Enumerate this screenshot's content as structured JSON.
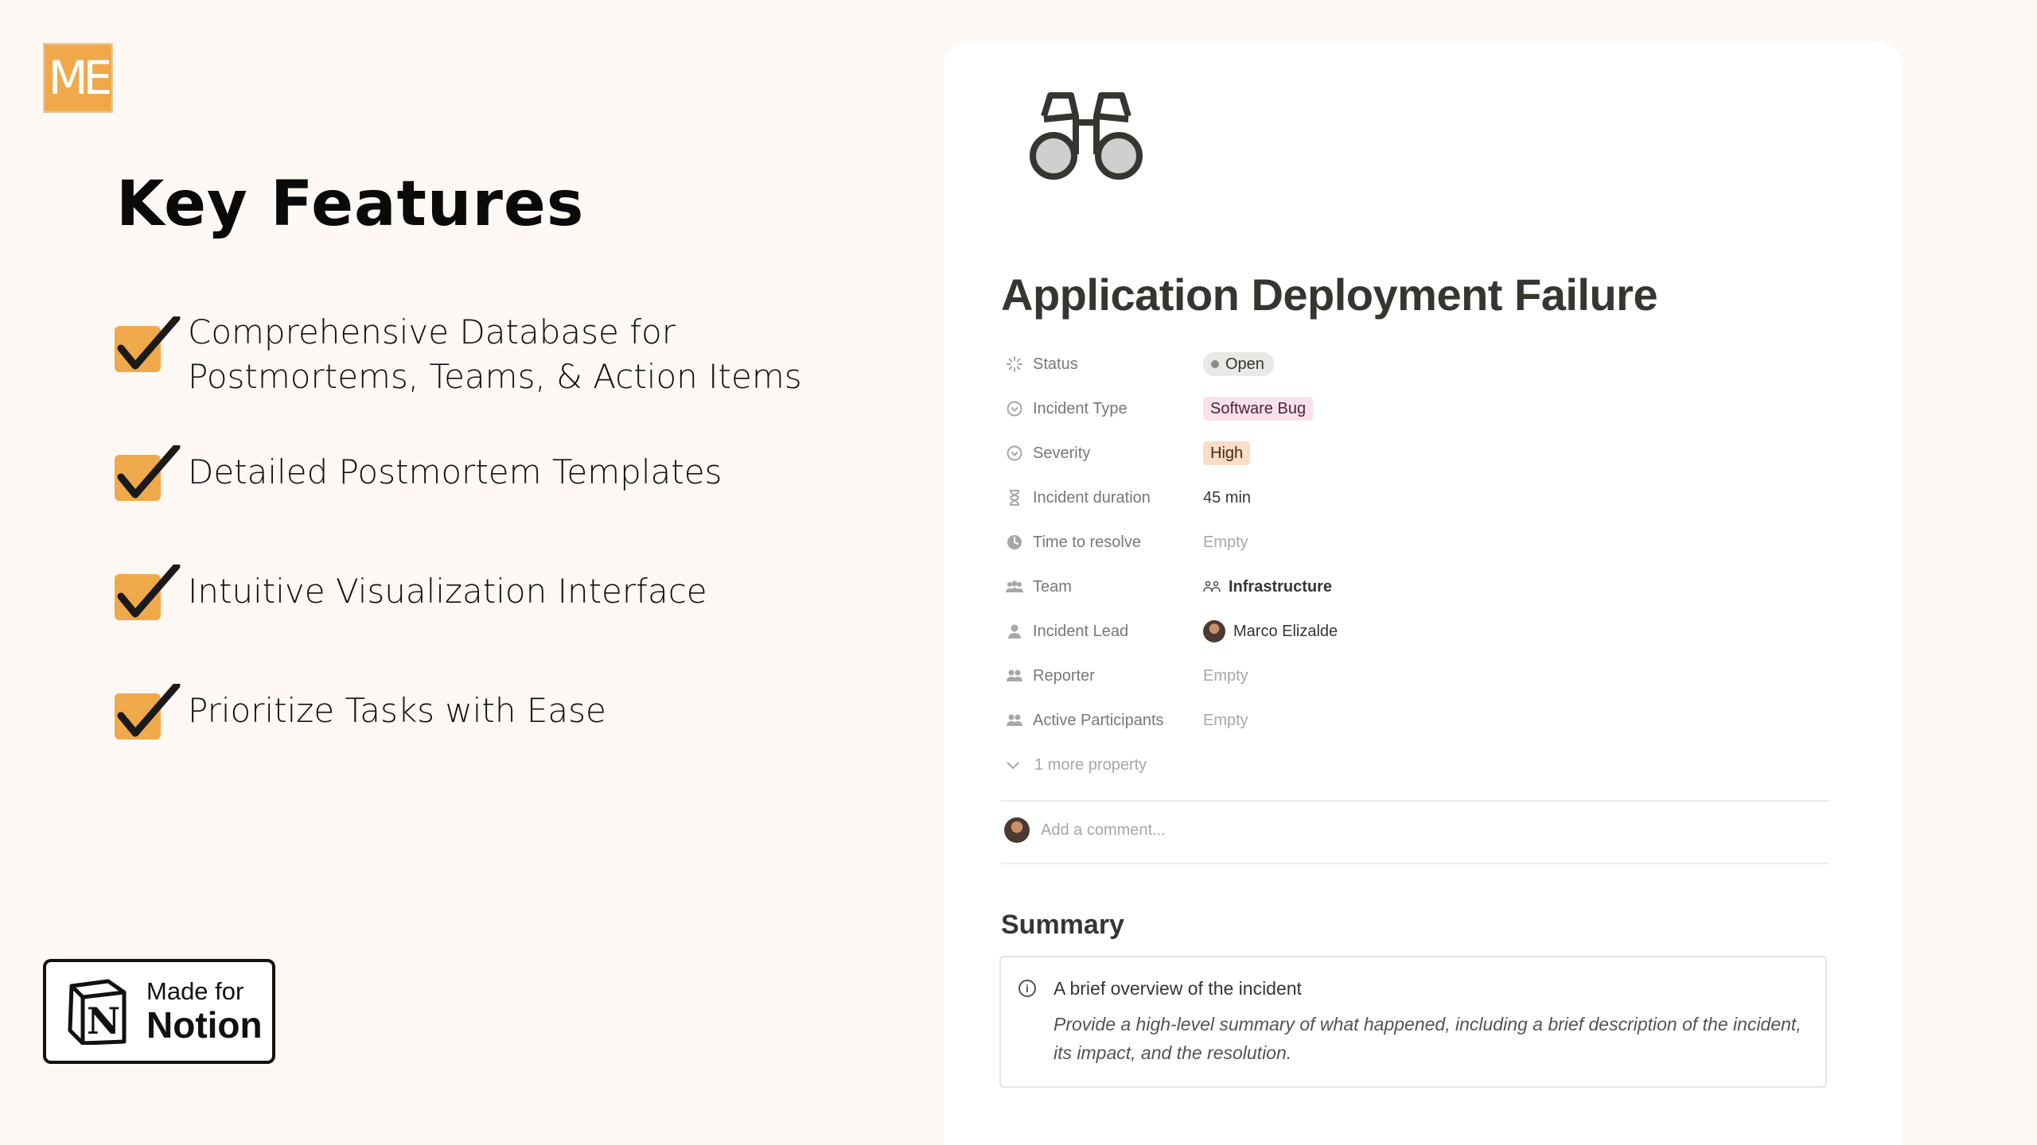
{
  "logo": {
    "text": "ME",
    "color": "#f0a94a"
  },
  "heading": "Key Features",
  "features": [
    {
      "line1": "Comprehensive Database for",
      "line2": "Postmortems, Teams, & Action Items"
    },
    {
      "line1": "Detailed Postmortem Templates"
    },
    {
      "line1": "Intuitive Visualization Interface"
    },
    {
      "line1": "Prioritize Tasks with Ease"
    }
  ],
  "badge": {
    "made": "Made for",
    "notion": "Notion"
  },
  "page": {
    "icon": "binoculars-icon",
    "title": "Application Deployment Failure",
    "properties": [
      {
        "name": "Status",
        "icon": "status-icon",
        "value": "Open"
      },
      {
        "name": "Incident Type",
        "icon": "select-icon",
        "value": "Software Bug"
      },
      {
        "name": "Severity",
        "icon": "select-icon",
        "value": "High"
      },
      {
        "name": "Incident duration",
        "icon": "hourglass-icon",
        "value": "45 min"
      },
      {
        "name": "Time to resolve",
        "icon": "clock-icon",
        "value": "Empty"
      },
      {
        "name": "Team",
        "icon": "people-icon",
        "value": "Infrastructure"
      },
      {
        "name": "Incident Lead",
        "icon": "person-icon",
        "value": "Marco Elizalde"
      },
      {
        "name": "Reporter",
        "icon": "people-icon",
        "value": "Empty"
      },
      {
        "name": "Active Participants",
        "icon": "people-icon",
        "value": "Empty"
      }
    ],
    "more_property": "1 more property",
    "comment_placeholder": "Add a comment...",
    "summary_heading": "Summary",
    "callout": {
      "title": "A brief overview of the incident",
      "body": "Provide a high-level summary of what happened, including a brief description of the incident, its impact, and the resolution."
    }
  },
  "colors": {
    "background": "#fdf8f3",
    "check": "#f0a94a",
    "bug_tag": "#f9e1ec",
    "high_tag": "#fbdcc7"
  }
}
